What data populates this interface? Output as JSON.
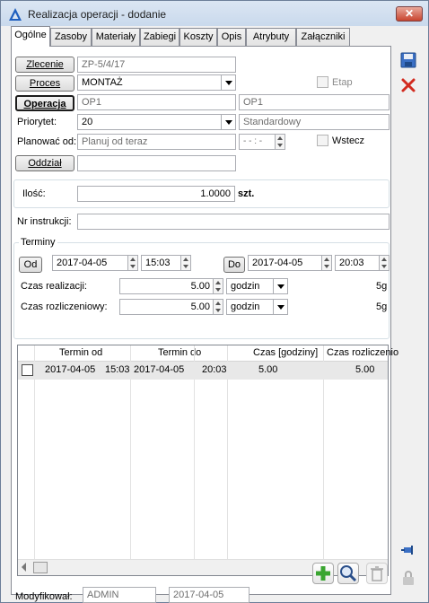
{
  "window": {
    "title": "Realizacja operacji - dodanie",
    "close_glyph": "✕"
  },
  "tabs": [
    "Ogólne",
    "Zasoby",
    "Materiały",
    "Zabiegi",
    "Koszty",
    "Opis",
    "Atrybuty",
    "Załączniki"
  ],
  "form": {
    "zlecenie_label": "Zlecenie",
    "zlecenie_value": "ZP-5/4/17",
    "proces_label": "Proces",
    "proces_value": "MONTAŻ",
    "etap_label": "Etap",
    "operacja_label": "Operacja",
    "operacja_code": "OP1",
    "operacja_name": "OP1",
    "priorytet_label": "Priorytet:",
    "priorytet_value": "20",
    "priorytet_name": "Standardowy",
    "planowac_label": "Planować od:",
    "planowac_value": "Planuj od teraz",
    "time_placeholder": "- - : -",
    "wstecz_label": "Wstecz",
    "oddzial_label": "Oddział",
    "oddzial_value": "",
    "ilosc_label": "Ilość:",
    "ilosc_value": "1.0000",
    "ilosc_unit": "szt.",
    "nr_instrukcji_label": "Nr instrukcji:",
    "nr_instrukcji_value": ""
  },
  "terminy": {
    "title": "Terminy",
    "od_label": "Od",
    "od_date": "2017-04-05",
    "od_time": "15:03",
    "do_label": "Do",
    "do_date": "2017-04-05",
    "do_time": "20:03",
    "czas_realizacji_label": "Czas realizacji:",
    "czas_realizacji_value": "5.00",
    "czas_realizacji_unit": "godzin",
    "czas_realizacji_short": "5g",
    "czas_rozliczeniowy_label": "Czas rozliczeniowy:",
    "czas_rozliczeniowy_value": "5.00",
    "czas_rozliczeniowy_unit": "godzin",
    "czas_rozliczeniowy_short": "5g"
  },
  "grid": {
    "columns": [
      "Termin od",
      "Termin do",
      "Czas [godziny]",
      "Czas rozliczenio"
    ],
    "rows": [
      {
        "od_date": "2017-04-05",
        "od_time": "15:03",
        "do_date": "2017-04-05",
        "do_time": "20:03",
        "czas": "5.00",
        "czas_rozl": "5.00"
      }
    ]
  },
  "footer": {
    "modyfikowal_label": "Modyfikował:",
    "modyfikowal_user": "ADMIN",
    "modyfikowal_date": "2017-04-05"
  },
  "icons": {
    "app": "app-logo-icon",
    "save": "save-icon",
    "cancel": "cancel-icon",
    "pin": "pin-icon",
    "lock": "lock-icon",
    "add": "add-icon",
    "search": "search-icon",
    "delete": "trash-icon"
  },
  "colors": {
    "accent": "#1f5fbf",
    "cancel": "#d22b1f",
    "add": "#3aa531"
  }
}
